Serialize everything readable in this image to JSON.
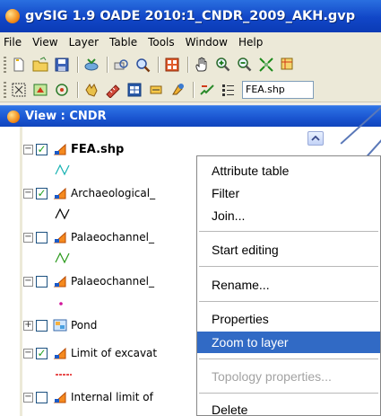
{
  "window": {
    "title": "gvSIG 1.9 OADE 2010:1_CNDR_2009_AKH.gvp"
  },
  "menubar": {
    "items": [
      "File",
      "View",
      "Layer",
      "Table",
      "Tools",
      "Window",
      "Help"
    ]
  },
  "toolbar": {
    "active_layer_combo": "FEA.shp"
  },
  "view": {
    "title": "View : CNDR"
  },
  "toc": {
    "layers": [
      {
        "name": "FEA.shp",
        "checked": true,
        "legend_color": "#19b3b3"
      },
      {
        "name": "Archaeological_",
        "checked": true,
        "legend_color": "#000000"
      },
      {
        "name": "Palaeochannel_",
        "checked": false,
        "legend_color": "#2b9a1c"
      },
      {
        "name": "Palaeochannel_",
        "checked": false,
        "legend_color": "#d2149a"
      },
      {
        "name": "Pond",
        "checked": false
      },
      {
        "name": "Limit of excavat",
        "checked": true,
        "legend_color": "#e01616"
      },
      {
        "name": "Internal limit of",
        "checked": false
      }
    ]
  },
  "context_menu": {
    "items": [
      {
        "label": "Attribute table",
        "state": "normal"
      },
      {
        "label": "Filter",
        "state": "normal"
      },
      {
        "label": "Join...",
        "state": "normal"
      },
      {
        "label": "Start editing",
        "state": "normal"
      },
      {
        "label": "Rename...",
        "state": "normal"
      },
      {
        "label": "Properties",
        "state": "normal"
      },
      {
        "label": "Zoom to layer",
        "state": "highlighted"
      },
      {
        "label": "Topology properties...",
        "state": "disabled"
      },
      {
        "label": "Delete",
        "state": "normal"
      }
    ]
  },
  "colors": {
    "titlebar": "#1146c7",
    "highlight": "#316ac5",
    "menu_bg": "#ece9d8"
  }
}
